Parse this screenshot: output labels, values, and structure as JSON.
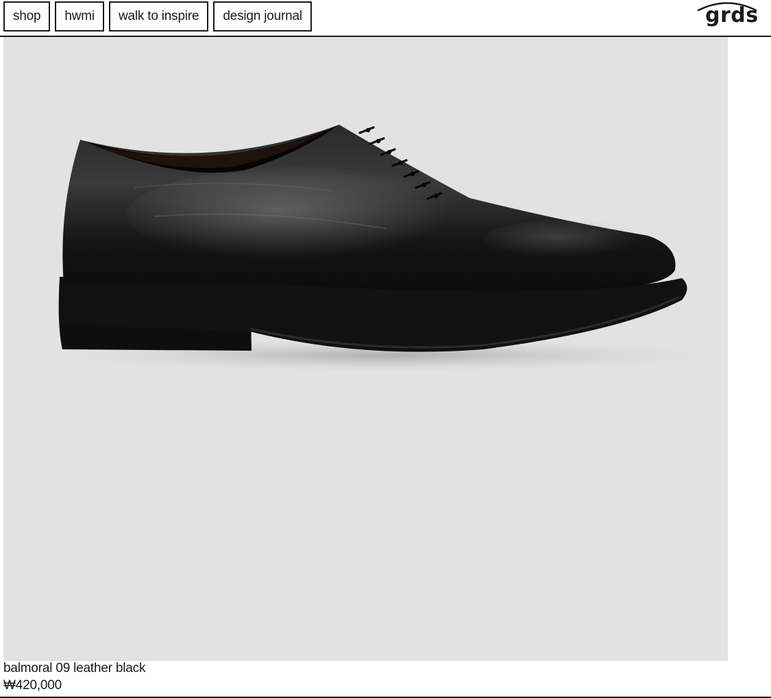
{
  "nav": {
    "items": [
      {
        "label": "shop"
      },
      {
        "label": "hwmi"
      },
      {
        "label": "walk to inspire"
      },
      {
        "label": "design journal"
      }
    ]
  },
  "brand": {
    "logo_text": "grds"
  },
  "product": {
    "name": "balmoral 09 leather black",
    "price": "₩420,000",
    "image_icon": "black-leather-oxford-shoe",
    "image_background": "#e2e2e2",
    "shoe_color": "#111111"
  },
  "colors": {
    "text": "#1a1a1a",
    "border": "#1a1a1a",
    "background": "#ffffff"
  }
}
